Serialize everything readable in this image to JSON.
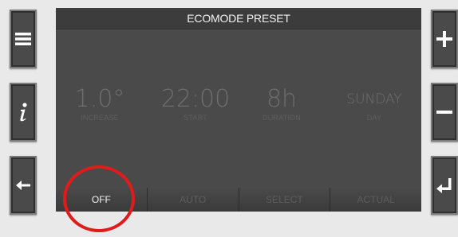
{
  "screen": {
    "title": "ECOMODE PRESET"
  },
  "params": [
    {
      "value": "1.0°",
      "label": "INCREASE"
    },
    {
      "value": "22:00",
      "label": "START"
    },
    {
      "value": "8h",
      "label": "DURATION"
    },
    {
      "value": "SUNDAY",
      "label": "DAY"
    }
  ],
  "softkeys": [
    {
      "label": "OFF",
      "active": true
    },
    {
      "label": "AUTO",
      "active": false
    },
    {
      "label": "SELECT",
      "active": false
    },
    {
      "label": "ACTUAL",
      "active": false
    }
  ],
  "side_buttons": {
    "left": [
      "menu-icon",
      "info-icon",
      "back-arrow-icon"
    ],
    "right": [
      "plus-icon",
      "minus-icon",
      "enter-icon"
    ]
  },
  "colors": {
    "screen_bg": "#4a4a4a",
    "header_bg": "#3c3c3c",
    "active_text": "#f0f0f0",
    "inactive_text": "#5d5d5d",
    "highlight": "#e01b1b"
  }
}
